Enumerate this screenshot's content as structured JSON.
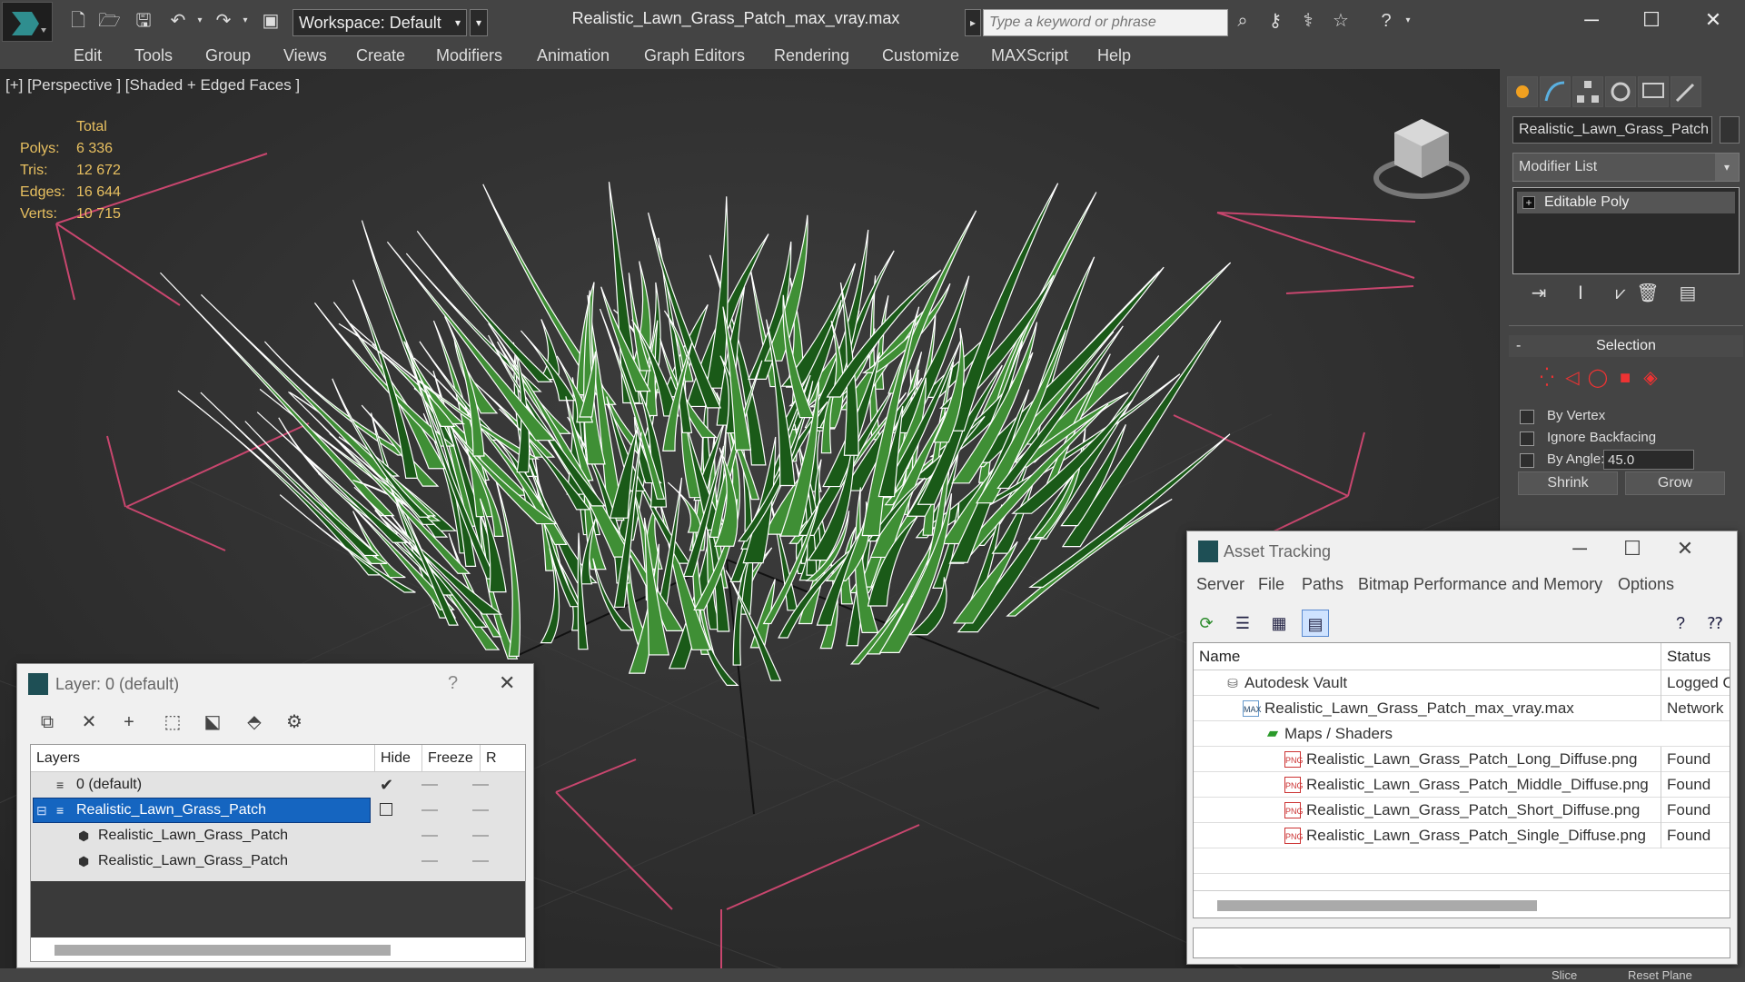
{
  "app": {
    "workspace_label": "Workspace: Default",
    "document_title": "Realistic_Lawn_Grass_Patch_max_vray.max",
    "search_placeholder": "Type a keyword or phrase"
  },
  "menu": [
    "Edit",
    "Tools",
    "Group",
    "Views",
    "Create",
    "Modifiers",
    "Animation",
    "Graph Editors",
    "Rendering",
    "Customize",
    "MAXScript",
    "Help"
  ],
  "viewport": {
    "label": "[+] [Perspective ] [Shaded + Edged Faces ]",
    "stats": {
      "header": "Total",
      "rows": [
        {
          "key": "Polys:",
          "value": "6 336"
        },
        {
          "key": "Tris:",
          "value": "12 672"
        },
        {
          "key": "Edges:",
          "value": "16 644"
        },
        {
          "key": "Verts:",
          "value": "10 715"
        }
      ]
    },
    "colors": {
      "grass_dark": "#1a5a18",
      "grass_light": "#3f8f35",
      "wire": "#ffffff",
      "grid": "#c8466e",
      "stats": "#e8c060"
    }
  },
  "command_panel": {
    "object_name": "Realistic_Lawn_Grass_Patch",
    "modifier_list": "Modifier List",
    "stack_item": "Editable Poly",
    "selection": {
      "title": "Selection",
      "minus": "-",
      "by_vertex": "By Vertex",
      "ignore_backfacing": "Ignore Backfacing",
      "by_angle": "By Angle:",
      "angle_value": "45.0",
      "shrink": "Shrink",
      "grow": "Grow"
    }
  },
  "layer_window": {
    "title": "Layer: 0 (default)",
    "help": "?",
    "columns": {
      "layers": "Layers",
      "hide": "Hide",
      "freeze": "Freeze",
      "render": "R"
    },
    "rows": [
      {
        "name": "0 (default)",
        "check": "✔"
      },
      {
        "name": "Realistic_Lawn_Grass_Patch"
      },
      {
        "name": "Realistic_Lawn_Grass_Patch"
      },
      {
        "name": "Realistic_Lawn_Grass_Patch"
      }
    ]
  },
  "asset_window": {
    "title": "Asset Tracking",
    "menu": [
      "Server",
      "File",
      "Paths",
      "Bitmap Performance and Memory",
      "Options"
    ],
    "columns": {
      "name": "Name",
      "status": "Status"
    },
    "rows": [
      {
        "name": "Autodesk Vault",
        "status": "Logged O"
      },
      {
        "name": "Realistic_Lawn_Grass_Patch_max_vray.max",
        "status": "Network"
      },
      {
        "name": "Maps / Shaders",
        "status": ""
      },
      {
        "name": "Realistic_Lawn_Grass_Patch_Long_Diffuse.png",
        "status": "Found"
      },
      {
        "name": "Realistic_Lawn_Grass_Patch_Middle_Diffuse.png",
        "status": "Found"
      },
      {
        "name": "Realistic_Lawn_Grass_Patch_Short_Diffuse.png",
        "status": "Found"
      },
      {
        "name": "Realistic_Lawn_Grass_Patch_Single_Diffuse.png",
        "status": "Found"
      }
    ],
    "png_badge": "PNG",
    "max_badge": "MAX"
  },
  "bottom": {
    "slice": "Slice",
    "reset_plane": "Reset Plane"
  }
}
